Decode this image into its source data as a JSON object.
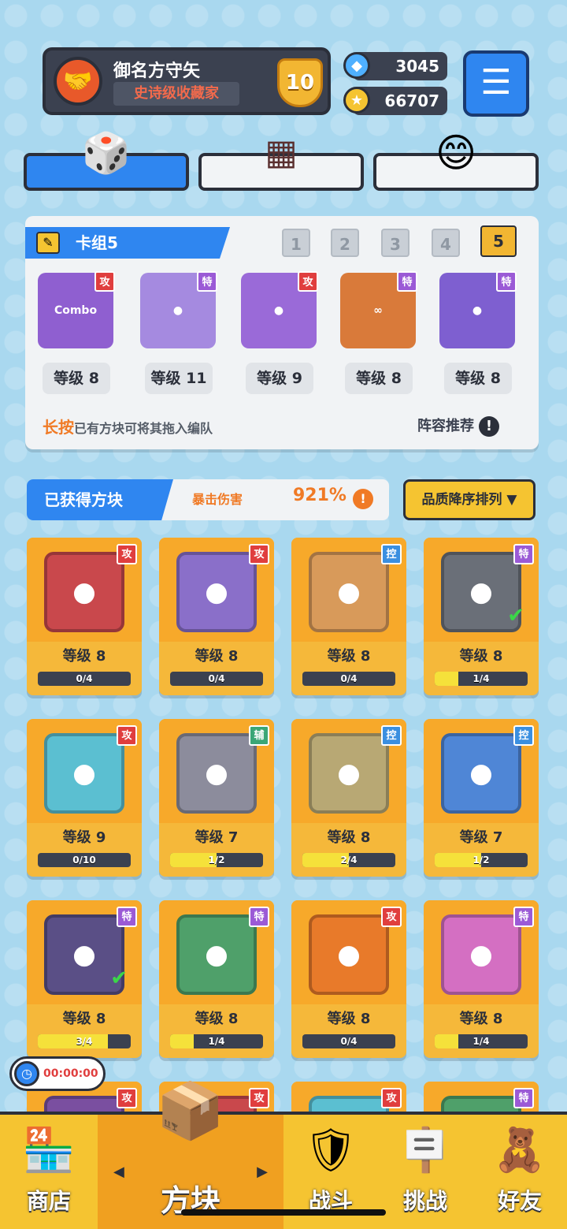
{
  "header": {
    "player_name": "御名方守矢",
    "player_title": "史诗级收藏家",
    "rank_level": "10",
    "gems": "3045",
    "coins": "66707"
  },
  "deck": {
    "title": "卡组5",
    "deck_numbers": [
      "1",
      "2",
      "3",
      "4",
      "5"
    ],
    "active_deck": "5",
    "cards": [
      {
        "tag": "攻",
        "level": "等级 8",
        "center": "Combo",
        "tone": "spe"
      },
      {
        "tag": "特",
        "level": "等级 11",
        "center": "●",
        "tone": "spe"
      },
      {
        "tag": "攻",
        "level": "等级 9",
        "center": "●",
        "tone": "spe"
      },
      {
        "tag": "特",
        "level": "等级 8",
        "center": "∞",
        "tone": "spe"
      },
      {
        "tag": "特",
        "level": "等级 8",
        "center": "●",
        "tone": "spe"
      }
    ],
    "hint_emphasis": "长按",
    "hint_text": "已有方块可将其拖入编队",
    "recommend_label": "阵容推荐"
  },
  "owned": {
    "title": "已获得方块",
    "crit_label": "暴击伤害",
    "crit_value": "921%",
    "sort_label": "品质降序排列 ▼"
  },
  "cards": [
    {
      "tag": "攻",
      "level": "等级 8",
      "progress": "0/4",
      "fill": 0,
      "tone": "atk",
      "color": "#c9484c",
      "checked": false
    },
    {
      "tag": "攻",
      "level": "等级 8",
      "progress": "0/4",
      "fill": 0,
      "tone": "atk",
      "color": "#8a6fc9",
      "checked": false
    },
    {
      "tag": "控",
      "level": "等级 8",
      "progress": "0/4",
      "fill": 0,
      "tone": "ctl",
      "color": "#d89a5a",
      "checked": false
    },
    {
      "tag": "特",
      "level": "等级 8",
      "progress": "1/4",
      "fill": 0.25,
      "tone": "spe",
      "color": "#6a6f78",
      "checked": true
    },
    {
      "tag": "攻",
      "level": "等级 9",
      "progress": "0/10",
      "fill": 0,
      "tone": "atk",
      "color": "#5bbfd1",
      "checked": false
    },
    {
      "tag": "辅",
      "level": "等级 7",
      "progress": "1/2",
      "fill": 0.5,
      "tone": "sup",
      "color": "#8c8c9c",
      "checked": false
    },
    {
      "tag": "控",
      "level": "等级 8",
      "progress": "2/4",
      "fill": 0.5,
      "tone": "ctl",
      "color": "#b8a874",
      "checked": false
    },
    {
      "tag": "控",
      "level": "等级 7",
      "progress": "1/2",
      "fill": 0.5,
      "tone": "ctl",
      "color": "#4f86d6",
      "checked": false
    },
    {
      "tag": "特",
      "level": "等级 8",
      "progress": "3/4",
      "fill": 0.75,
      "tone": "spe",
      "color": "#5a4f86",
      "checked": true
    },
    {
      "tag": "特",
      "level": "等级 8",
      "progress": "1/4",
      "fill": 0.25,
      "tone": "spe",
      "color": "#4fa06a",
      "checked": false
    },
    {
      "tag": "攻",
      "level": "等级 8",
      "progress": "0/4",
      "fill": 0,
      "tone": "atk",
      "color": "#e87a2a",
      "checked": false
    },
    {
      "tag": "特",
      "level": "等级 8",
      "progress": "1/4",
      "fill": 0.25,
      "tone": "spe",
      "color": "#d46fc2",
      "checked": false
    },
    {
      "tag": "攻",
      "tone": "atk",
      "color": "#7a4fa0"
    },
    {
      "tag": "攻",
      "tone": "atk",
      "color": "#c9484c"
    },
    {
      "tag": "攻",
      "tone": "atk",
      "color": "#5bbfd1"
    },
    {
      "tag": "特",
      "tone": "spe",
      "color": "#4fa06a"
    }
  ],
  "timer": "00:00:00",
  "nav": {
    "shop": "商店",
    "blocks": "方块",
    "battle": "战斗",
    "challenge": "挑战",
    "friends": "好友"
  }
}
